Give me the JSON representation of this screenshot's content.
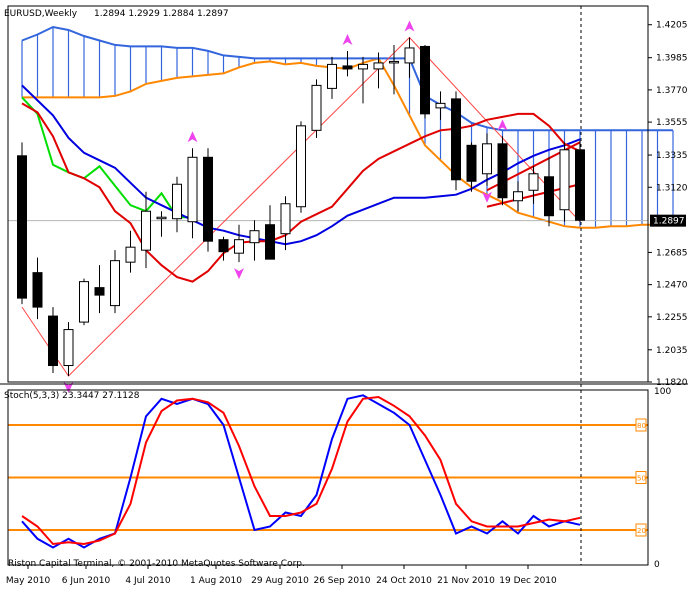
{
  "chart_data": [
    {
      "type": "candlestick",
      "title": "EURUSD,Weekly",
      "ohlc_readout": "1.2894 1.2929 1.2884 1.2897",
      "current_price": "1.2897",
      "y_tick_labels": [
        "1.4205",
        "1.3985",
        "1.3770",
        "1.3555",
        "1.3335",
        "1.3120",
        "1.2685",
        "1.2470",
        "1.2255",
        "1.2035",
        "1.1820"
      ],
      "ylim": [
        1.182,
        1.433
      ],
      "x_tick_labels": [
        "May 2010",
        "6 Jun 2010",
        "4 Jul 2010",
        "1 Aug 2010",
        "29 Aug 2010",
        "26 Sep 2010",
        "24 Oct 2010",
        "21 Nov 2010",
        "19 Dec 2010"
      ],
      "candles": [
        {
          "o": 1.333,
          "h": 1.342,
          "l": 1.234,
          "c": 1.238
        },
        {
          "o": 1.255,
          "h": 1.265,
          "l": 1.224,
          "c": 1.232
        },
        {
          "o": 1.226,
          "h": 1.232,
          "l": 1.188,
          "c": 1.193
        },
        {
          "o": 1.193,
          "h": 1.222,
          "l": 1.186,
          "c": 1.217
        },
        {
          "o": 1.222,
          "h": 1.251,
          "l": 1.22,
          "c": 1.249
        },
        {
          "o": 1.245,
          "h": 1.26,
          "l": 1.228,
          "c": 1.24
        },
        {
          "o": 1.233,
          "h": 1.27,
          "l": 1.228,
          "c": 1.263
        },
        {
          "o": 1.262,
          "h": 1.283,
          "l": 1.255,
          "c": 1.272
        },
        {
          "o": 1.27,
          "h": 1.309,
          "l": 1.258,
          "c": 1.296
        },
        {
          "o": 1.291,
          "h": 1.296,
          "l": 1.279,
          "c": 1.292
        },
        {
          "o": 1.291,
          "h": 1.319,
          "l": 1.282,
          "c": 1.314
        },
        {
          "o": 1.289,
          "h": 1.338,
          "l": 1.278,
          "c": 1.332
        },
        {
          "o": 1.332,
          "h": 1.338,
          "l": 1.269,
          "c": 1.276
        },
        {
          "o": 1.277,
          "h": 1.279,
          "l": 1.263,
          "c": 1.269
        },
        {
          "o": 1.268,
          "h": 1.287,
          "l": 1.262,
          "c": 1.277
        },
        {
          "o": 1.275,
          "h": 1.29,
          "l": 1.263,
          "c": 1.283
        },
        {
          "o": 1.287,
          "h": 1.3,
          "l": 1.266,
          "c": 1.264
        },
        {
          "o": 1.281,
          "h": 1.306,
          "l": 1.27,
          "c": 1.301
        },
        {
          "o": 1.299,
          "h": 1.356,
          "l": 1.295,
          "c": 1.353
        },
        {
          "o": 1.35,
          "h": 1.384,
          "l": 1.345,
          "c": 1.38
        },
        {
          "o": 1.378,
          "h": 1.399,
          "l": 1.371,
          "c": 1.394
        },
        {
          "o": 1.393,
          "h": 1.403,
          "l": 1.386,
          "c": 1.391
        },
        {
          "o": 1.391,
          "h": 1.399,
          "l": 1.368,
          "c": 1.394
        },
        {
          "o": 1.391,
          "h": 1.402,
          "l": 1.378,
          "c": 1.395
        },
        {
          "o": 1.395,
          "h": 1.407,
          "l": 1.374,
          "c": 1.396
        },
        {
          "o": 1.395,
          "h": 1.412,
          "l": 1.385,
          "c": 1.405
        },
        {
          "o": 1.406,
          "h": 1.407,
          "l": 1.358,
          "c": 1.361
        },
        {
          "o": 1.365,
          "h": 1.376,
          "l": 1.357,
          "c": 1.368
        },
        {
          "o": 1.371,
          "h": 1.376,
          "l": 1.31,
          "c": 1.317
        },
        {
          "o": 1.34,
          "h": 1.342,
          "l": 1.309,
          "c": 1.316
        },
        {
          "o": 1.321,
          "h": 1.348,
          "l": 1.313,
          "c": 1.341
        },
        {
          "o": 1.341,
          "h": 1.346,
          "l": 1.3,
          "c": 1.305
        },
        {
          "o": 1.303,
          "h": 1.316,
          "l": 1.296,
          "c": 1.309
        },
        {
          "o": 1.31,
          "h": 1.326,
          "l": 1.301,
          "c": 1.321
        },
        {
          "o": 1.319,
          "h": 1.332,
          "l": 1.286,
          "c": 1.293
        },
        {
          "o": 1.297,
          "h": 1.342,
          "l": 1.289,
          "c": 1.337
        },
        {
          "o": 1.337,
          "h": 1.343,
          "l": 1.289,
          "c": 1.29
        }
      ],
      "tenkan": [
        1.368,
        1.362,
        1.346,
        1.322,
        1.318,
        1.312,
        1.296,
        1.288,
        1.27,
        1.26,
        1.252,
        1.249,
        1.256,
        1.268,
        1.275,
        1.276,
        1.276,
        1.28,
        1.289,
        1.294,
        1.299,
        1.311,
        1.323,
        1.331,
        1.336,
        1.341,
        1.346,
        1.35,
        1.351,
        1.353,
        1.357,
        1.359,
        1.361,
        1.361,
        1.353,
        1.341,
        1.336
      ],
      "kijun": [
        1.38,
        1.37,
        1.36,
        1.345,
        1.335,
        1.33,
        1.325,
        1.315,
        1.305,
        1.3,
        1.295,
        1.29,
        1.285,
        1.283,
        1.28,
        1.278,
        1.276,
        1.274,
        1.276,
        1.28,
        1.286,
        1.293,
        1.297,
        1.301,
        1.305,
        1.305,
        1.305,
        1.306,
        1.307,
        1.311,
        1.317,
        1.322,
        1.328,
        1.333,
        1.337,
        1.34,
        1.344
      ],
      "chikou": [
        1.372,
        1.361,
        1.327,
        1.322,
        1.318,
        1.326,
        1.313,
        1.3,
        1.296,
        1.308,
        1.292,
        1.292
      ],
      "span_a": [
        1.372,
        1.372,
        1.372,
        1.372,
        1.372,
        1.372,
        1.373,
        1.376,
        1.381,
        1.383,
        1.385,
        1.386,
        1.387,
        1.388,
        1.392,
        1.395,
        1.396,
        1.394,
        1.395,
        1.393,
        1.392,
        1.391,
        1.395,
        1.398,
        1.38,
        1.36,
        1.34,
        1.33,
        1.32,
        1.312,
        1.307,
        1.302,
        1.295,
        1.292,
        1.289,
        1.286,
        1.285,
        1.285,
        1.286,
        1.286,
        1.287,
        1.287,
        1.287
      ],
      "span_b": [
        1.41,
        1.414,
        1.419,
        1.417,
        1.413,
        1.41,
        1.407,
        1.406,
        1.406,
        1.406,
        1.405,
        1.405,
        1.403,
        1.4,
        1.399,
        1.398,
        1.398,
        1.398,
        1.398,
        1.398,
        1.398,
        1.398,
        1.398,
        1.398,
        1.398,
        1.398,
        1.373,
        1.367,
        1.362,
        1.355,
        1.352,
        1.35,
        1.35,
        1.35,
        1.35,
        1.35,
        1.35,
        1.35,
        1.35,
        1.35,
        1.35,
        1.35,
        1.35
      ],
      "zigzag": [
        [
          0,
          1.232
        ],
        [
          3,
          1.186
        ],
        [
          25,
          1.412
        ],
        [
          36,
          1.289
        ]
      ],
      "triangle_upper": [
        [
          30,
          1.31
        ],
        [
          36,
          1.342
        ]
      ],
      "triangle_lower": [
        [
          30,
          1.299
        ],
        [
          36,
          1.314
        ]
      ],
      "arrows_up": [
        11,
        21,
        25,
        31
      ],
      "arrows_down": [
        3,
        14,
        30
      ]
    },
    {
      "type": "line",
      "title": "Stoch(5,3,3) 23.3447 27.1128",
      "y_tick_labels": [
        "100",
        "0"
      ],
      "ylim": [
        0,
        100
      ],
      "levels": [
        {
          "value": 80,
          "label": "80"
        },
        {
          "value": 50,
          "label": "50"
        },
        {
          "value": 20,
          "label": "20"
        }
      ],
      "series": [
        {
          "values": [
            25,
            15,
            10,
            15,
            10,
            15,
            18,
            50,
            85,
            95,
            92,
            95,
            92,
            80,
            50,
            20,
            22,
            30,
            28,
            40,
            72,
            95,
            97,
            92,
            87,
            80,
            60,
            40,
            18,
            22,
            18,
            25,
            18,
            28,
            22,
            25,
            23
          ]
        },
        {
          "values": [
            28,
            22,
            12,
            13,
            12,
            14,
            18,
            35,
            70,
            88,
            94,
            95,
            93,
            87,
            68,
            45,
            28,
            28,
            30,
            35,
            55,
            82,
            95,
            96,
            91,
            85,
            74,
            60,
            35,
            25,
            22,
            22,
            22,
            24,
            26,
            25,
            27
          ]
        }
      ]
    }
  ],
  "footer": {
    "copyright": "Riston Capital Terminal, © 2001-2010 MetaQuotes Software Corp."
  },
  "colors": {
    "bull_body": "#ffffff",
    "bear_body": "#000000",
    "tenkan": "#e00000",
    "kijun": "#0000e0",
    "chikou": "#00dd00",
    "cloud_a": "#ff8800",
    "cloud_b": "#3366dd",
    "zigzag": "#ff4444",
    "triangle": "#dd0000",
    "arrow": "#ee44ee",
    "stoch_main": "#0000ff",
    "stoch_signal": "#ff0000",
    "level": "#ff8800",
    "grid": "#b4b4b4"
  }
}
